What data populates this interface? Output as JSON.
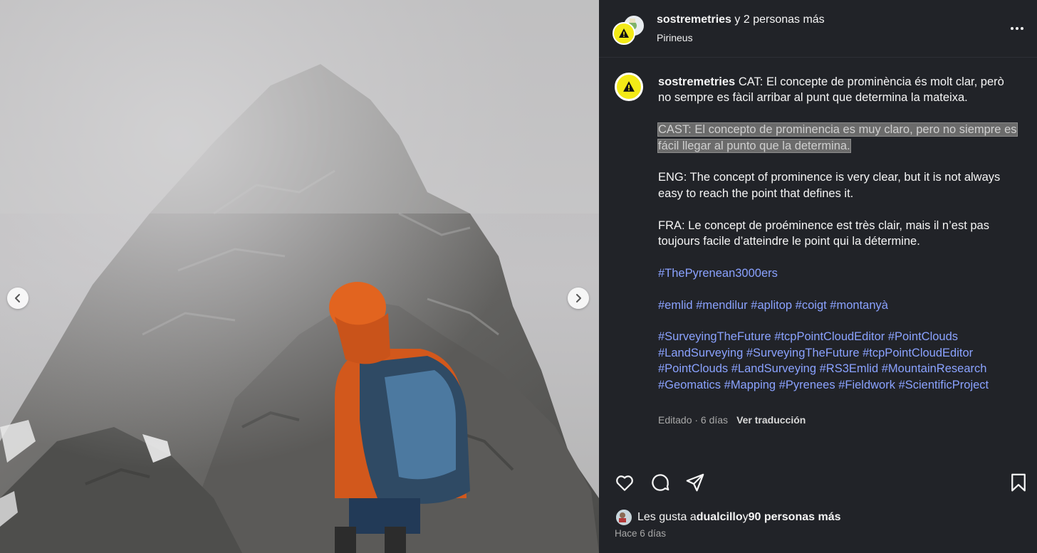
{
  "header": {
    "author": "sostremetries",
    "coauthors_text": " y 2 personas más",
    "location": "Pirineus"
  },
  "caption": {
    "username": "sostremetries",
    "cat": "CAT: El concepte de prominència és molt clar, però no sempre es fàcil arribar al punt que determina la mateixa.",
    "cast": "CAST: El concepto de prominencia es muy claro, pero no siempre es fácil llegar al punto que la determina.",
    "eng": "ENG: The concept of prominence is very clear, but it is not always easy to reach the point that defines it.",
    "fra": "FRA: Le concept de proéminence est très clair, mais il n’est pas toujours facile d’atteindre le point qui la détermine.",
    "hashtags_1": [
      "#ThePyrenean3000ers"
    ],
    "hashtags_2": [
      "#emlid",
      "#mendilur",
      "#aplitop",
      "#coigt",
      "#montanyà"
    ],
    "hashtags_3": [
      "#SurveyingTheFuture",
      "#tcpPointCloudEditor",
      "#PointClouds",
      "#LandSurveying",
      "#SurveyingTheFuture",
      "#tcpPointCloudEditor",
      "#PointClouds",
      "#LandSurveying",
      "#RS3Emlid",
      "#MountainResearch",
      "#Geomatics",
      "#Mapping",
      "#Pyrenees",
      "#Fieldwork",
      "#ScientificProject"
    ]
  },
  "meta": {
    "edited": "Editado · 6 días",
    "translate": "Ver traducción"
  },
  "likes": {
    "prefix": "Les gusta a ",
    "user": "dualcillo",
    "middle": " y ",
    "count": "90 personas más"
  },
  "posted_ago": "Hace 6 días",
  "icons": {
    "prev": "chevron-left-icon",
    "next": "chevron-right-icon",
    "like": "heart-icon",
    "comment": "comment-icon",
    "share": "send-icon",
    "save": "bookmark-icon",
    "more": "more-options-icon"
  },
  "colors": {
    "panel_bg": "#212328",
    "hashtag": "#8aa2ff",
    "avatar_yellow": "#f3ea17"
  }
}
